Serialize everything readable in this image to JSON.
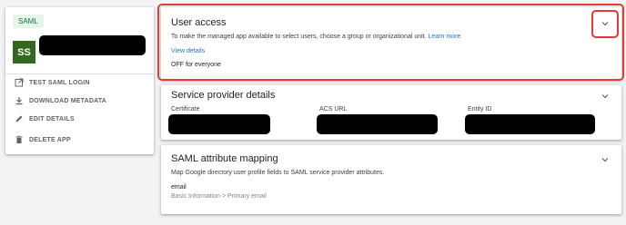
{
  "app_info": {
    "badge": "SAML",
    "avatar_initials": "SS"
  },
  "actions": [
    {
      "label": "TEST SAML LOGIN",
      "icon": "open-in-new-icon"
    },
    {
      "label": "DOWNLOAD METADATA",
      "icon": "download-icon"
    },
    {
      "label": "EDIT DETAILS",
      "icon": "pencil-icon"
    },
    {
      "label": "DELETE APP",
      "icon": "trash-icon"
    }
  ],
  "user_access": {
    "title": "User access",
    "description": "To make the managed app available to select users, choose a group or organizational unit.",
    "learn_more": "Learn more",
    "view_details": "View details",
    "status": "OFF for everyone"
  },
  "service_provider": {
    "title": "Service provider details",
    "fields": [
      {
        "label": "Certificate"
      },
      {
        "label": "ACS URL"
      },
      {
        "label": "Entity ID"
      }
    ]
  },
  "attribute_mapping": {
    "title": "SAML attribute mapping",
    "description": "Map Google directory user profile fields to SAML service provider attributes.",
    "attribute_name": "email",
    "attribute_source": "Basic Information > Primary email"
  },
  "colors": {
    "accent": "#1a73e8",
    "highlight": "#e53935",
    "avatar": "#33691e",
    "badge_bg": "#e6f4ea",
    "badge_text": "#137333"
  }
}
